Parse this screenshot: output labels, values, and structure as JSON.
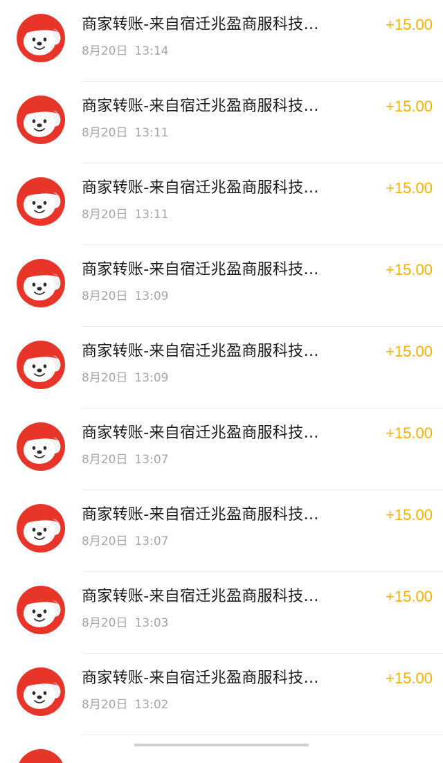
{
  "colors": {
    "amount": "#f5b000",
    "title": "#1a1a1a",
    "time": "#a6a6a6",
    "avatar_red": "#e8352a"
  },
  "avatar_icon": "jd-dog-mascot-icon",
  "transactions": [
    {
      "title": "商家转账-来自宿迁兆盈商服科技…",
      "date": "8月20日",
      "time": "13:14",
      "amount": "+15.00"
    },
    {
      "title": "商家转账-来自宿迁兆盈商服科技…",
      "date": "8月20日",
      "time": "13:11",
      "amount": "+15.00"
    },
    {
      "title": "商家转账-来自宿迁兆盈商服科技…",
      "date": "8月20日",
      "time": "13:11",
      "amount": "+15.00"
    },
    {
      "title": "商家转账-来自宿迁兆盈商服科技…",
      "date": "8月20日",
      "time": "13:09",
      "amount": "+15.00"
    },
    {
      "title": "商家转账-来自宿迁兆盈商服科技…",
      "date": "8月20日",
      "time": "13:09",
      "amount": "+15.00"
    },
    {
      "title": "商家转账-来自宿迁兆盈商服科技…",
      "date": "8月20日",
      "time": "13:07",
      "amount": "+15.00"
    },
    {
      "title": "商家转账-来自宿迁兆盈商服科技…",
      "date": "8月20日",
      "time": "13:07",
      "amount": "+15.00"
    },
    {
      "title": "商家转账-来自宿迁兆盈商服科技…",
      "date": "8月20日",
      "time": "13:03",
      "amount": "+15.00"
    },
    {
      "title": "商家转账-来自宿迁兆盈商服科技…",
      "date": "8月20日",
      "time": "13:02",
      "amount": "+15.00"
    }
  ]
}
